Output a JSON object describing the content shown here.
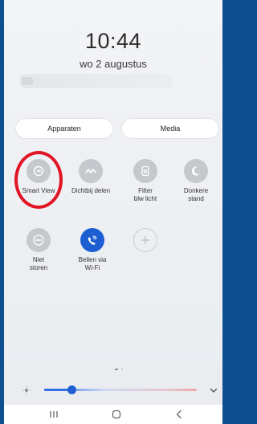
{
  "lockscreen": {
    "time": "10:44",
    "date": "wo 2 augustus"
  },
  "buttons": {
    "devices": "Apparaten",
    "media": "Media"
  },
  "tiles": [
    {
      "label": "Smart View",
      "icon": "smart-view-icon",
      "state": "off"
    },
    {
      "label": "Dichtbij delen",
      "icon": "nearby-share-icon",
      "state": "off"
    },
    {
      "label": "Filter\nblw licht",
      "icon": "blue-light-filter-icon",
      "state": "off"
    },
    {
      "label": "Donkere\nstand",
      "icon": "dark-mode-icon",
      "state": "off"
    },
    {
      "label": "Niet\nstoren",
      "icon": "do-not-disturb-icon",
      "state": "off"
    },
    {
      "label": "Bellen via\nWi-Fi",
      "icon": "wifi-calling-icon",
      "state": "on"
    },
    {
      "label": "",
      "icon": "add-icon",
      "state": "add"
    }
  ],
  "brightness": {
    "level": 0.18
  },
  "colors": {
    "accent": "#1d5fd3",
    "highlight_ring": "#e01424",
    "tile_off": "#c5c8cc",
    "background": "#0d4f8f"
  },
  "nav": {
    "recent": "recent-apps-icon",
    "home": "home-icon",
    "back": "back-icon"
  }
}
